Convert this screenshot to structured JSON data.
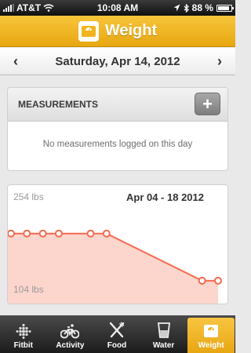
{
  "status_bar": {
    "carrier": "AT&T",
    "time": "10:08 AM",
    "battery_percent": "88 %",
    "battery_level": 0.88
  },
  "header": {
    "title": "Weight",
    "icon": "scale-icon"
  },
  "date_nav": {
    "prev_label": "‹",
    "next_label": "›",
    "date": "Saturday, Apr 14, 2012"
  },
  "measurements": {
    "title": "MEASUREMENTS",
    "add_label": "+",
    "empty_message": "No measurements logged on this day"
  },
  "chart": {
    "range_label": "Apr 04 - 18 2012",
    "colors": {
      "line": "#f26b4f",
      "fill": "#fcd5cc"
    }
  },
  "chart_data": {
    "type": "area",
    "title": "",
    "xlabel": "",
    "ylabel": "",
    "tick_labels": {
      "y_max": "254 lbs",
      "y_min": "104 lbs"
    },
    "ylim": [
      104,
      254
    ],
    "x": [
      0,
      1,
      2,
      3,
      5,
      6,
      12,
      13
    ],
    "values": [
      200,
      200,
      200,
      200,
      200,
      200,
      129,
      129
    ],
    "marker": "open-circle",
    "grid": false
  },
  "tabs": [
    {
      "id": "fitbit",
      "label": "Fitbit",
      "icon": "fitbit-dots-icon",
      "active": false
    },
    {
      "id": "activity",
      "label": "Activity",
      "icon": "bicycle-icon",
      "active": false
    },
    {
      "id": "food",
      "label": "Food",
      "icon": "fork-knife-icon",
      "active": false
    },
    {
      "id": "water",
      "label": "Water",
      "icon": "glass-icon",
      "active": false
    },
    {
      "id": "weight",
      "label": "Weight",
      "icon": "scale-icon",
      "active": true
    }
  ]
}
